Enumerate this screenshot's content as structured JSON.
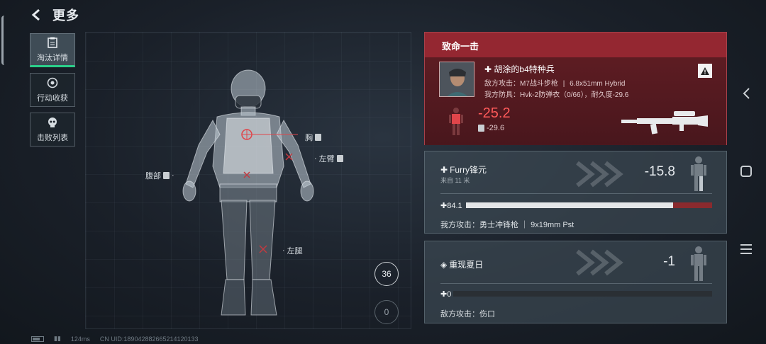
{
  "header": {
    "title": "更多"
  },
  "sidebar": {
    "items": [
      {
        "label": "淘汰详情",
        "icon": "clipboard-icon",
        "active": true
      },
      {
        "label": "行动收获",
        "icon": "coin-icon",
        "active": false
      },
      {
        "label": "击败列表",
        "icon": "skull-icon",
        "active": false
      }
    ]
  },
  "body_hits": {
    "chest": "胸",
    "left_arm": "左臂",
    "abdomen": "腹部",
    "left_leg": "左腿"
  },
  "badges": {
    "top": "36",
    "bottom": "0"
  },
  "status": {
    "ping": "124ms",
    "uid": "CN UID:18904288266521412013​3"
  },
  "fatal_hit": {
    "title": "致命一击",
    "killer_name": "胡涂的b4特种兵",
    "enemy_weapon_label": "敌方攻击：",
    "enemy_weapon": "M7战斗步枪",
    "enemy_ammo": "6.8x51mm Hybrid",
    "my_armor_label": "我方防具：",
    "my_armor": "Hvk-2防弹衣（0/66），耐久度-29.6",
    "hp_damage": "-25.2",
    "armor_damage": "-29.6"
  },
  "events": [
    {
      "name": "Furry锋元",
      "distance": "来自 11 米",
      "damage": "-15.8",
      "hp": "84.1",
      "hp_fraction": 0.841,
      "lost_fraction": 0.158,
      "weapon_line": "我方攻击：勇士冲锋枪 ｜ 9x19mm Pst"
    },
    {
      "name": "重现夏日",
      "damage": "-1",
      "hp": "0",
      "hp_fraction": 0,
      "lost_fraction": 0,
      "weapon_line": "敌方攻击：伤口"
    }
  ],
  "colors": {
    "accent": "#2ad08a",
    "danger": "#ff5a5a",
    "fatal_bg": "#801e26"
  }
}
